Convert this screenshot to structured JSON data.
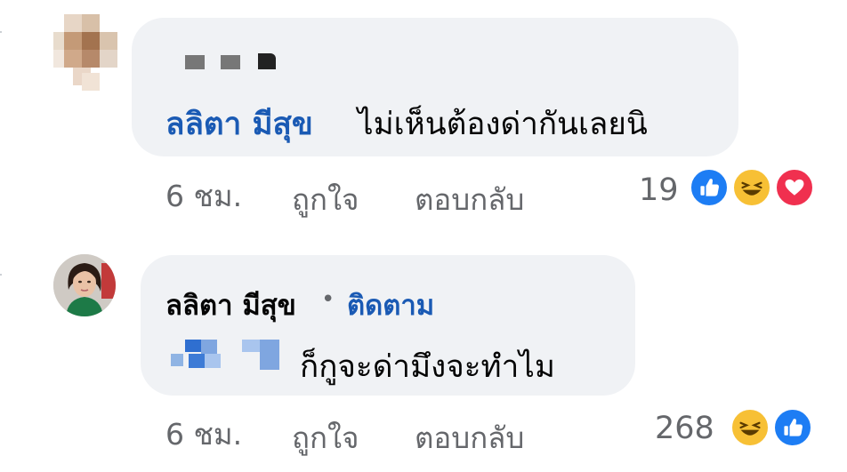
{
  "comments": [
    {
      "author": "ลลิตา มีสุข",
      "text": "ไม่เห็นต้องด่ากันเลยนิ",
      "time": "6 ชม.",
      "like_action": "ถูกใจ",
      "reply_action": "ตอบกลับ",
      "reaction_count": "19",
      "reactions": [
        "like-icon",
        "haha-icon",
        "love-icon"
      ]
    },
    {
      "author": "ลลิตา มีสุข",
      "follow_separator": "•",
      "follow_action": "ติดตาม",
      "text": "ก็กูจะด่ามึงจะทำไม",
      "time": "6 ชม.",
      "like_action": "ถูกใจ",
      "reply_action": "ตอบกลับ",
      "reaction_count": "268",
      "reactions": [
        "haha-icon",
        "like-icon"
      ]
    }
  ],
  "colors": {
    "bubble": "#f0f2f5",
    "name_link": "#1a5ab4",
    "meta_text": "#65676b",
    "like": "#1d7df4",
    "haha": "#f7c035",
    "love": "#f0304f"
  }
}
